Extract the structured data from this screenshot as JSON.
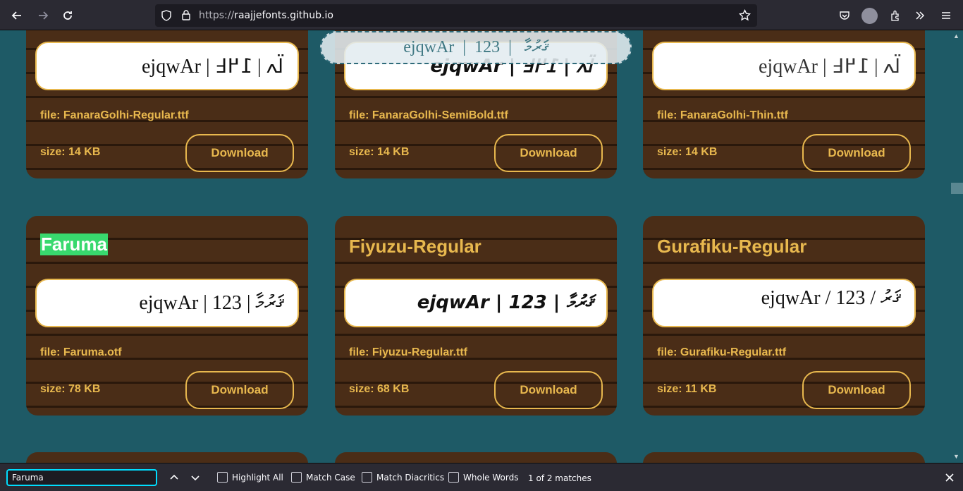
{
  "browser": {
    "url_scheme": "https://",
    "url_host": "raajjefonts.github.io"
  },
  "fonts_row1": [
    {
      "preview": "ejqwAr | ߊ߳ߍ | ߁߂߃",
      "file": "file: FanaraGolhi-Regular.ttf",
      "size": "size: 14 KB",
      "download": "Download"
    },
    {
      "preview": "ejqwAr | ߊ߳ߍ | ߁߂߃",
      "file": "file: FanaraGolhi-SemiBold.ttf",
      "size": "size: 14 KB",
      "download": "Download"
    },
    {
      "preview": "ejqwAr | ߊ߳ߍ | ߁߂߃",
      "file": "file: FanaraGolhi-Thin.ttf",
      "size": "size: 14 KB",
      "download": "Download"
    }
  ],
  "fonts_row2": [
    {
      "title": "Faruma",
      "preview": "ejqwAr  |  ޤަރުމާ   |  123",
      "file": "file: Faruma.otf",
      "size": "size: 78 KB",
      "download": "Download"
    },
    {
      "title": "Fiyuzu-Regular",
      "preview": "ejqwAr | ޤަރުމާ | 123",
      "file": "file: Fiyuzu-Regular.ttf",
      "size": "size: 68 KB",
      "download": "Download"
    },
    {
      "title": "Gurafiku-Regular",
      "preview": "ejqwAr / ޤަރު / 123",
      "file": "file: Gurafiku-Regular.ttf",
      "size": "size: 11 KB",
      "download": "Download"
    }
  ],
  "floating_preview": "ejqwAr  |  ޤަރުމާ   |  123",
  "find": {
    "query": "Faruma",
    "highlight_all": "Highlight All",
    "match_case": "Match Case",
    "match_diacritics": "Match Diacritics",
    "whole_words": "Whole Words",
    "match_count": "1 of 2 matches"
  },
  "colors": {
    "page_bg": "#1e5a66",
    "card_bg": "#4a2d17",
    "accent_gold": "#e8b84e",
    "find_highlight": "#38d96e"
  }
}
